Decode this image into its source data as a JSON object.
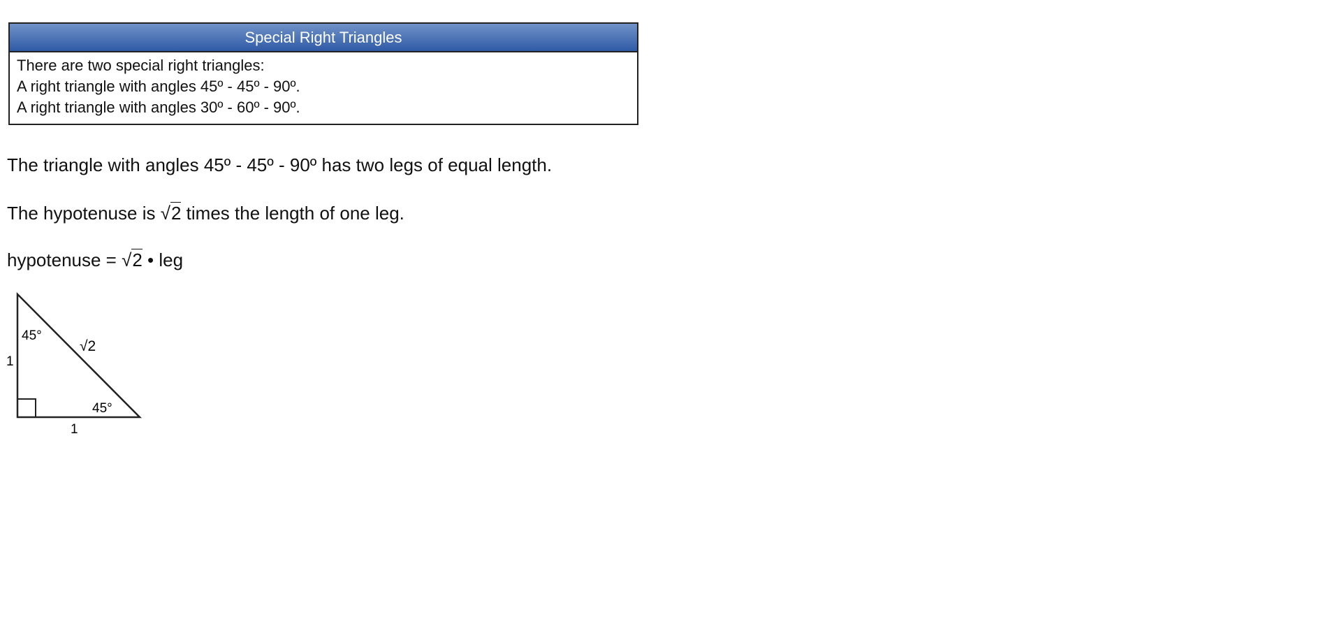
{
  "box": {
    "title": "Special Right Triangles",
    "lines": [
      "There are two special right triangles:",
      "A right triangle with angles 45º - 45º - 90º.",
      "A right triangle with angles 30º - 60º - 90º."
    ]
  },
  "text": {
    "p1": "The triangle with angles 45º - 45º - 90º has two legs of equal length.",
    "p2_before": "The hypotenuse is ",
    "p2_radical": "2",
    "p2_after": " times the length of one leg.",
    "formula_before": "hypotenuse = ",
    "formula_radical": "2",
    "formula_after": " • leg"
  },
  "diagram": {
    "top_angle": "45°",
    "bottom_angle": "45°",
    "hypotenuse": "√2",
    "left_leg": "1",
    "bottom_leg": "1"
  }
}
